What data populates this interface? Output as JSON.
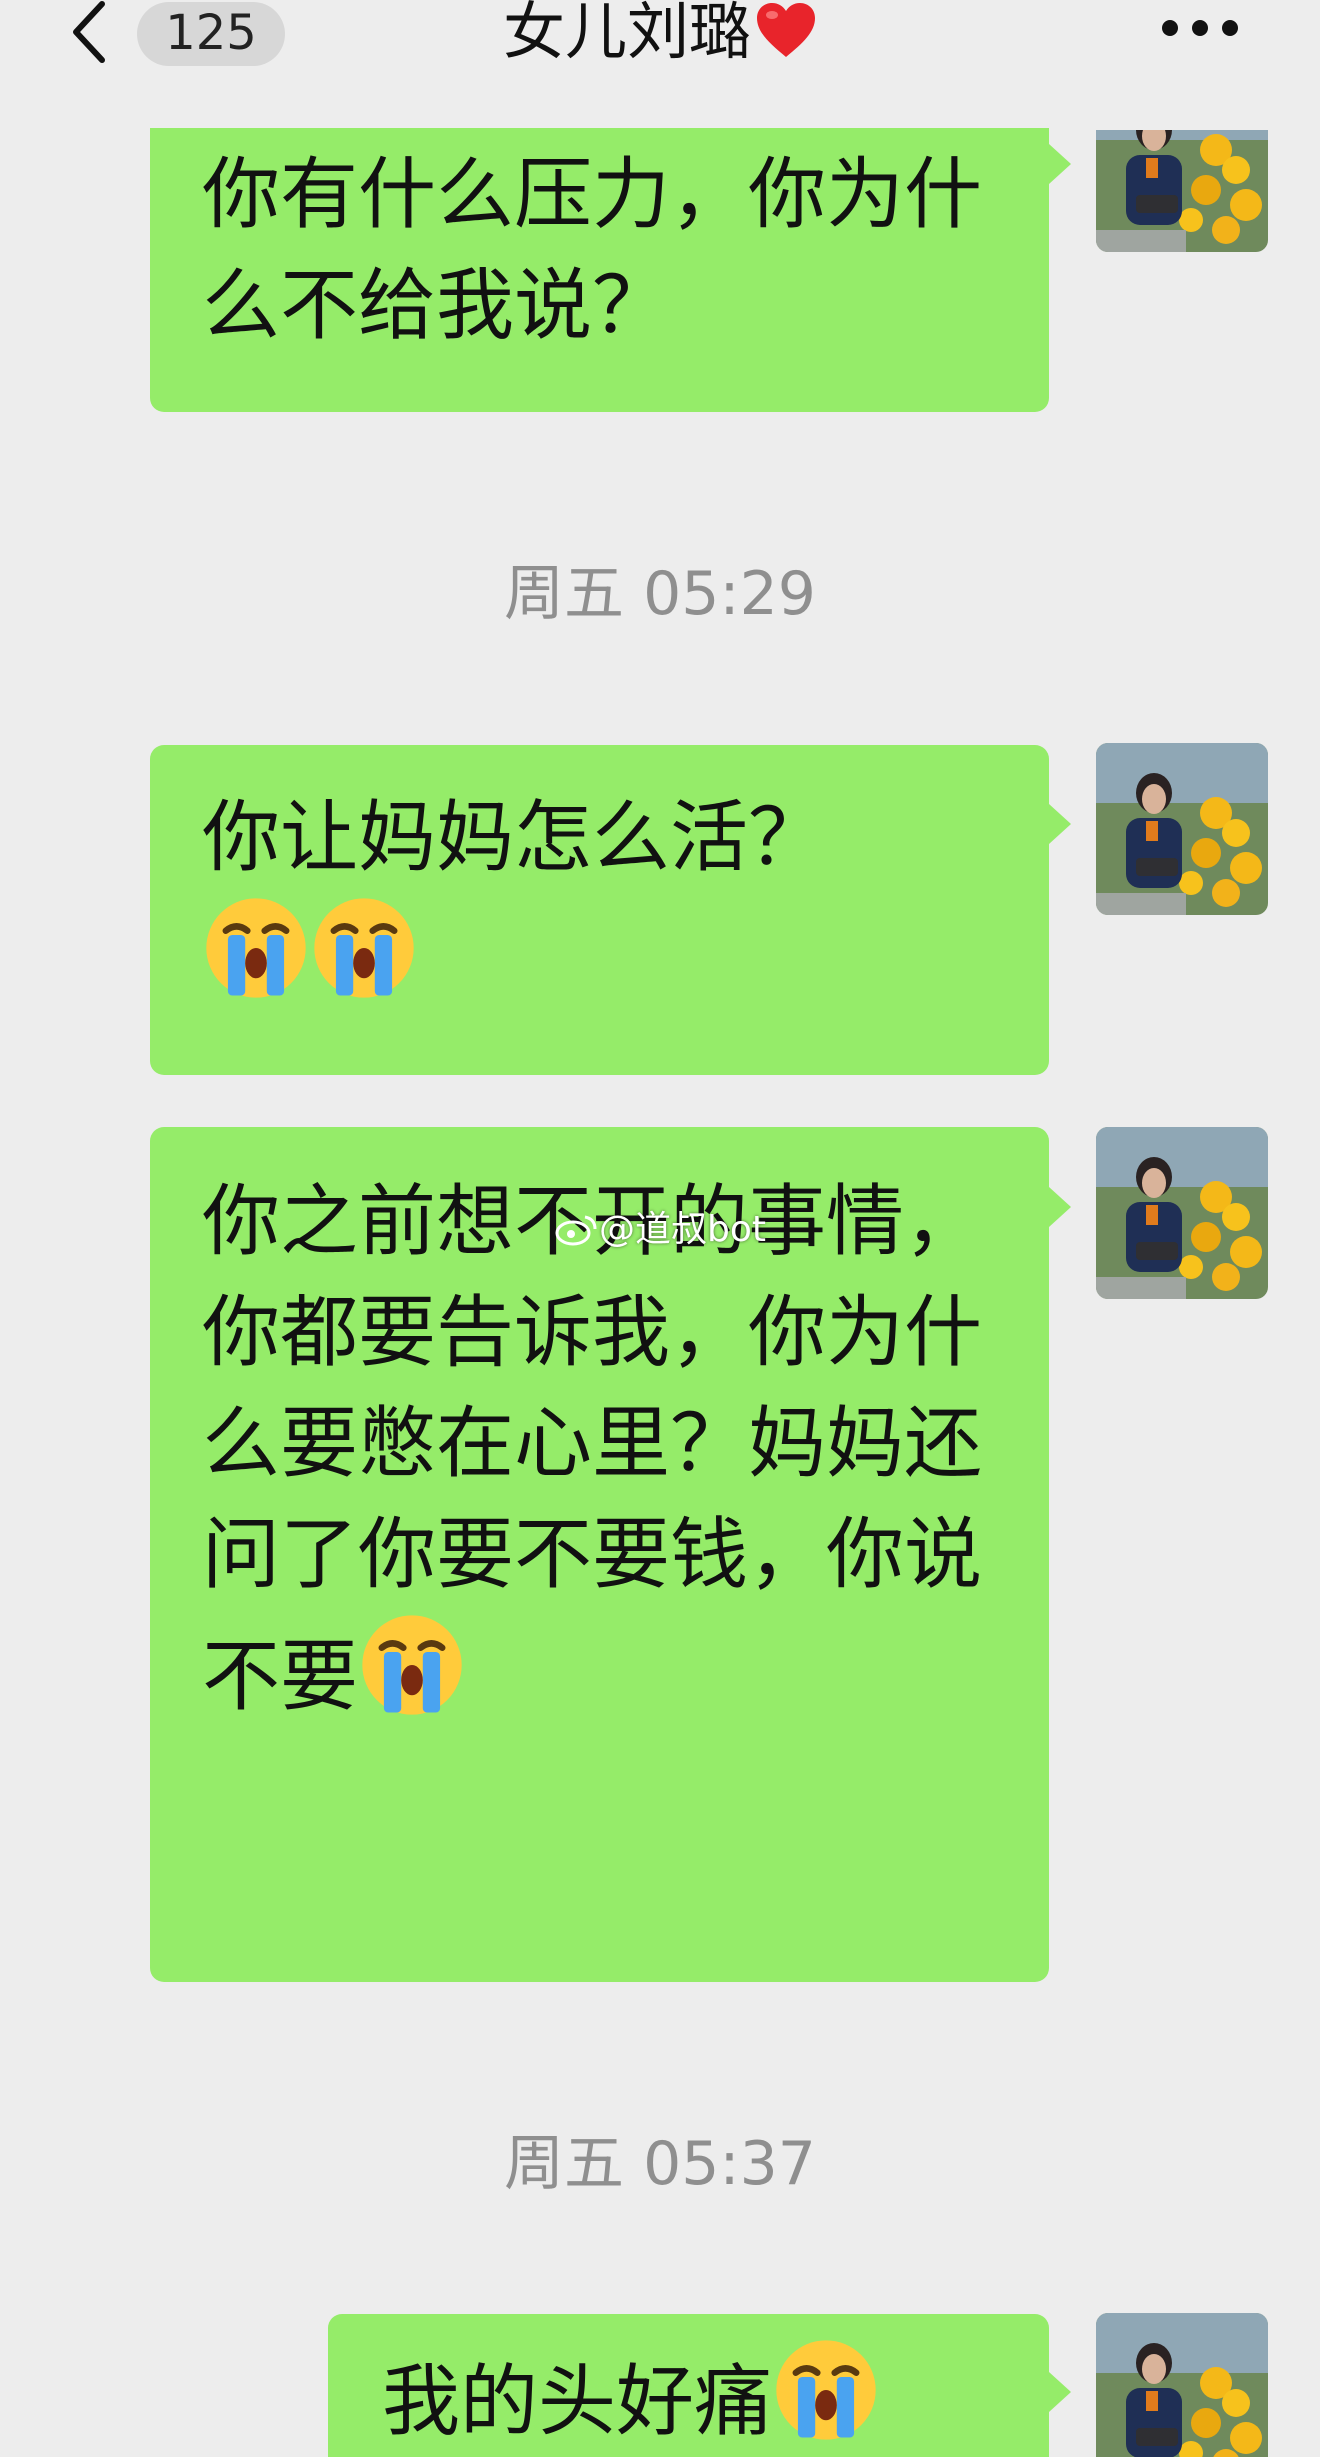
{
  "header": {
    "back_label": "back",
    "unread_count": "125",
    "title": "女儿刘璐",
    "title_icon": "red-heart-icon",
    "more_icon": "more-dots-icon"
  },
  "colors": {
    "background": "#ededed",
    "bubble_outgoing": "#95ec69",
    "timestamp_text": "#8f8f8f",
    "badge_bg": "#d7d7d7"
  },
  "messages": [
    {
      "type": "outgoing",
      "text": "你有什么压力，你为什么不给我说？"
    },
    {
      "type": "timestamp",
      "text": "周五 05:29"
    },
    {
      "type": "outgoing",
      "text": "你让妈妈怎么活？",
      "emojis": [
        "loudly-crying-face",
        "loudly-crying-face"
      ]
    },
    {
      "type": "outgoing",
      "text": "你之前想不开的事情，你都要告诉我，你为什么要憋在心里？妈妈还问了你要不要钱，你说不要",
      "emojis": [
        "loudly-crying-face"
      ]
    },
    {
      "type": "timestamp",
      "text": "周五 05:37"
    },
    {
      "type": "outgoing",
      "text": "我的头好痛",
      "emojis": [
        "loudly-crying-face"
      ]
    }
  ],
  "watermark": {
    "text": "@道叔bot",
    "icon": "weibo-icon"
  }
}
